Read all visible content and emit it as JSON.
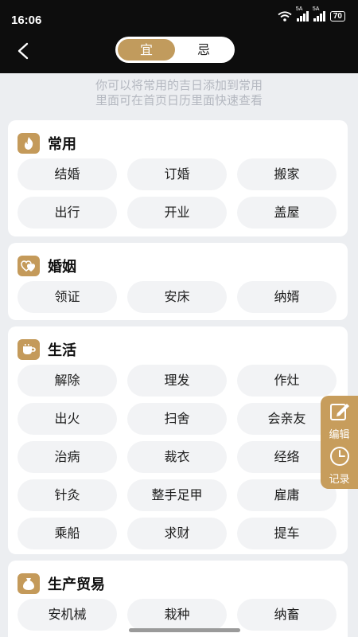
{
  "status_bar": {
    "time": "16:06",
    "sim1": "5A",
    "sim2": "5A",
    "battery": "70"
  },
  "header": {
    "segment": {
      "active": "宜",
      "inactive": "忌"
    }
  },
  "hint": {
    "line1": "你可以将常用的吉日添加到常用",
    "line2": "里面可在首页日历里面快速查看"
  },
  "categories": [
    {
      "title": "常用",
      "icon": "flame-icon",
      "items": [
        "结婚",
        "订婚",
        "搬家",
        "出行",
        "开业",
        "盖屋"
      ]
    },
    {
      "title": "婚姻",
      "icon": "hearts-icon",
      "items": [
        "领证",
        "安床",
        "纳婿"
      ]
    },
    {
      "title": "生活",
      "icon": "cup-icon",
      "items": [
        "解除",
        "理发",
        "作灶",
        "出火",
        "扫舍",
        "会亲友",
        "治病",
        "裁衣",
        "经络",
        "针灸",
        "整手足甲",
        "雇庸",
        "乘船",
        "求财",
        "提车"
      ]
    },
    {
      "title": "生产贸易",
      "icon": "money-bag-icon",
      "items": [
        "安机械",
        "栽种",
        "纳畜"
      ]
    }
  ],
  "float_panel": {
    "edit_label": "编辑",
    "record_label": "记录"
  },
  "colors": {
    "accent": "#c19b5d",
    "header_bg": "#0d0d0d",
    "page_bg": "#eceef1"
  }
}
